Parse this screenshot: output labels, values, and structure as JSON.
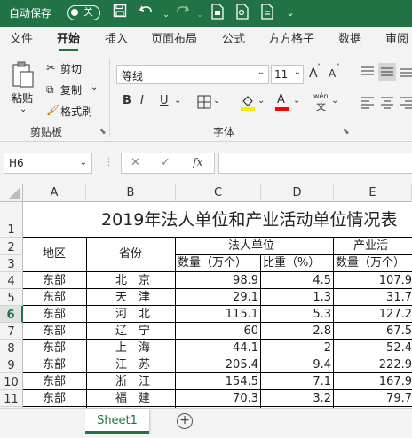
{
  "quick_access": {
    "autosave_label": "自动保存",
    "toggle_state": "关"
  },
  "menu": [
    "文件",
    "开始",
    "插入",
    "页面布局",
    "公式",
    "方方格子",
    "数据",
    "审阅"
  ],
  "ribbon": {
    "paste": "粘贴",
    "cut": "剪切",
    "copy": "复制",
    "format_painter": "格式刷",
    "clipboard_group": "剪贴板",
    "font_name": "等线",
    "font_size": "11",
    "font_group": "字体",
    "bold": "B",
    "italic": "I",
    "underline": "U",
    "grow_font": "A",
    "shrink_font": "A",
    "font_color_letter": "A",
    "accent_color": "#217346"
  },
  "formula_bar": {
    "name_box": "H6",
    "fx": "fx",
    "cancel": "✕",
    "enter": "✓"
  },
  "columns": [
    "A",
    "B",
    "C",
    "D",
    "E"
  ],
  "row_numbers": [
    "1",
    "2",
    "3",
    "4",
    "5",
    "6",
    "7",
    "8",
    "9",
    "10",
    "11"
  ],
  "sheet": {
    "title": "2019年法人单位和产业活动单位情况表",
    "header_area": "地区",
    "header_province": "省份",
    "header_legal_units": "法人单位",
    "header_industry_units": "产业活",
    "sub_count": "数量（万个）",
    "sub_share": "比重（%）",
    "sub_count_e": "数量（万个）",
    "rows": [
      {
        "area": "东部",
        "province": "北　京",
        "count": "98.9",
        "share": "4.5",
        "e": "107.9"
      },
      {
        "area": "东部",
        "province": "天　津",
        "count": "29.1",
        "share": "1.3",
        "e": "31.7"
      },
      {
        "area": "东部",
        "province": "河　北",
        "count": "115.1",
        "share": "5.3",
        "e": "127.2"
      },
      {
        "area": "东部",
        "province": "辽　宁",
        "count": "60",
        "share": "2.8",
        "e": "67.5"
      },
      {
        "area": "东部",
        "province": "上　海",
        "count": "44.1",
        "share": "2",
        "e": "52.4"
      },
      {
        "area": "东部",
        "province": "江　苏",
        "count": "205.4",
        "share": "9.4",
        "e": "222.9"
      },
      {
        "area": "东部",
        "province": "浙　江",
        "count": "154.5",
        "share": "7.1",
        "e": "167.9"
      },
      {
        "area": "东部",
        "province": "福　建",
        "count": "70.3",
        "share": "3.2",
        "e": "79.7"
      }
    ]
  },
  "tabs": {
    "sheet1": "Sheet1",
    "add": "+"
  }
}
